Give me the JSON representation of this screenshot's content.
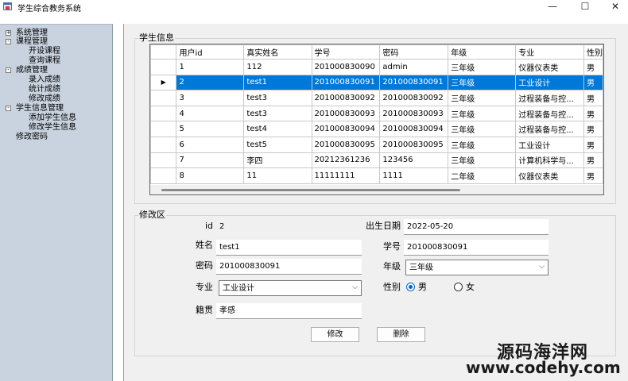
{
  "window": {
    "title": "学生综合教务系统",
    "minimize": "—",
    "maximize": "☐",
    "close": "✕"
  },
  "sidebar": {
    "items": [
      {
        "label": "系统管理",
        "expander": "+"
      },
      {
        "label": "课程管理",
        "expander": "-"
      },
      {
        "label": "开设课程"
      },
      {
        "label": "查询课程"
      },
      {
        "label": "成绩管理",
        "expander": "-"
      },
      {
        "label": "录入成绩"
      },
      {
        "label": "统计成绩"
      },
      {
        "label": "修改成绩"
      },
      {
        "label": "学生信息管理",
        "expander": "-"
      },
      {
        "label": "添加学生信息"
      },
      {
        "label": "修改学生信息"
      },
      {
        "label": "修改密码"
      }
    ]
  },
  "info_group": {
    "caption": "学生信息"
  },
  "grid": {
    "columns": [
      "用户id",
      "真实姓名",
      "学号",
      "密码",
      "年级",
      "专业",
      "性别"
    ],
    "row_indicator": "▶",
    "rows": [
      [
        "1",
        "112",
        "201000830090",
        "admin",
        "三年级",
        "仪器仪表类",
        "男"
      ],
      [
        "2",
        "test1",
        "201000830091",
        "201000830091",
        "三年级",
        "工业设计",
        "男"
      ],
      [
        "3",
        "test3",
        "201000830092",
        "201000830092",
        "三年级",
        "过程装备与控...",
        "男"
      ],
      [
        "4",
        "test3",
        "201000830093",
        "201000830093",
        "三年级",
        "过程装备与控...",
        "男"
      ],
      [
        "5",
        "test4",
        "201000830094",
        "201000830094",
        "三年级",
        "过程装备与控...",
        "男"
      ],
      [
        "6",
        "test5",
        "201000830095",
        "201000830095",
        "三年级",
        "工业设计",
        "男"
      ],
      [
        "7",
        "李四",
        "20212361236",
        "123456",
        "三年级",
        "计算机科学与...",
        "男"
      ],
      [
        "8",
        "11",
        "11111111",
        "1111",
        "二年级",
        "仪器仪表类",
        "男"
      ]
    ]
  },
  "edit_group": {
    "caption": "修改区"
  },
  "form": {
    "id_label": "id",
    "id_value": "2",
    "birth_label": "出生日期",
    "birth_value": "2022-05-20",
    "name_label": "姓名",
    "name_value": "test1",
    "stuno_label": "学号",
    "stuno_value": "201000830091",
    "pwd_label": "密码",
    "pwd_value": "201000830091",
    "grade_label": "年级",
    "grade_value": "三年级",
    "major_label": "专业",
    "major_value": "工业设计",
    "gender_label": "性别",
    "gender_male": "男",
    "gender_female": "女",
    "origin_label": "籍贯",
    "origin_value": "孝感",
    "modify_button": "修改",
    "delete_button": "删除"
  },
  "watermark": {
    "line1": "源码海洋网",
    "line2": "www.codehy.com"
  }
}
